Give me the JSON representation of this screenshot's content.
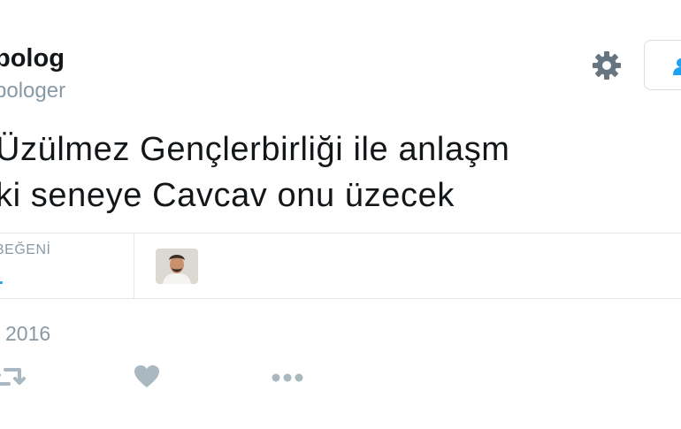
{
  "user": {
    "display_name": "bolog",
    "handle": "bologer"
  },
  "header": {
    "settings_icon": "gear-icon",
    "follow_icon": "follow-person-icon"
  },
  "tweet": {
    "lines": [
      " Üzülmez Gençlerbirliği ile anlaşm",
      "ki seneye Cavcav onu üzecek"
    ]
  },
  "stats": {
    "likes_label": "BEĞENİ",
    "likes_count": "1"
  },
  "date": "2016",
  "actions": {
    "retweet_icon": "retweet-icon",
    "like_icon": "heart-icon",
    "more_icon": "more-dots-icon"
  },
  "colors": {
    "accent": "#1da1f2",
    "muted": "#8899a6",
    "icon": "#aab8c2"
  }
}
